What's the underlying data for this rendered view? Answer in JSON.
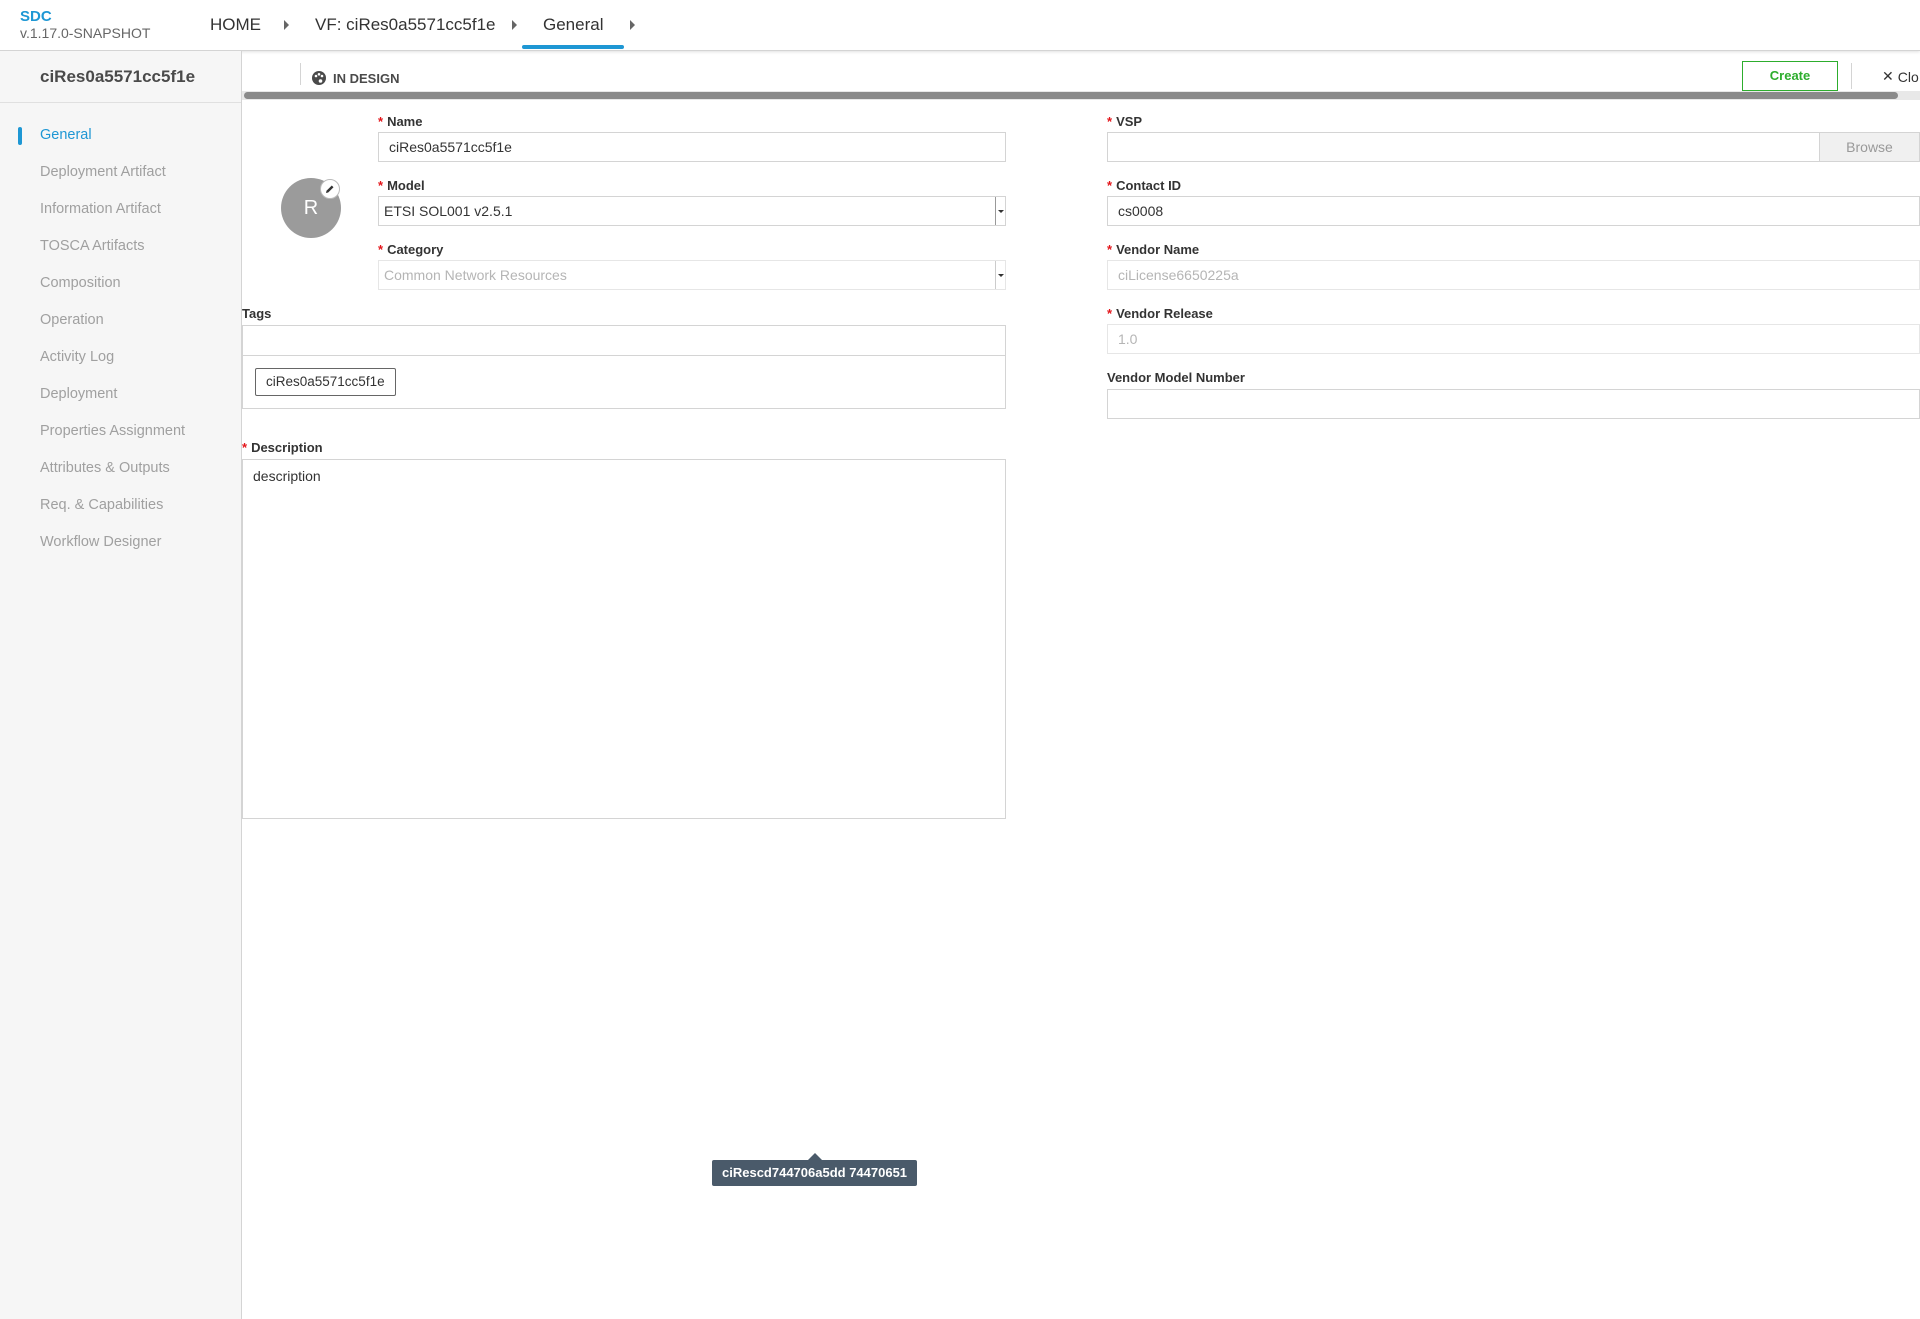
{
  "app": {
    "name": "SDC",
    "version": "v.1.17.0-SNAPSHOT"
  },
  "breadcrumb": {
    "home": "HOME",
    "vf": "VF: ciRes0a5571cc5f1e",
    "current": "General"
  },
  "sidebar": {
    "title": "ciRes0a5571cc5f1e",
    "items": [
      {
        "label": "General",
        "active": true
      },
      {
        "label": "Deployment Artifact"
      },
      {
        "label": "Information Artifact"
      },
      {
        "label": "TOSCA Artifacts"
      },
      {
        "label": "Composition"
      },
      {
        "label": "Operation"
      },
      {
        "label": "Activity Log"
      },
      {
        "label": "Deployment"
      },
      {
        "label": "Properties Assignment"
      },
      {
        "label": "Attributes & Outputs"
      },
      {
        "label": "Req. & Capabilities"
      },
      {
        "label": "Workflow Designer"
      }
    ]
  },
  "status": {
    "label": "IN DESIGN"
  },
  "actions": {
    "create": "Create",
    "close": "Clo"
  },
  "avatar": {
    "letter": "R"
  },
  "form": {
    "name": {
      "label": "Name",
      "value": "ciRes0a5571cc5f1e"
    },
    "model": {
      "label": "Model",
      "value": "ETSI SOL001 v2.5.1"
    },
    "category": {
      "label": "Category",
      "value": "Common Network Resources"
    },
    "tags": {
      "label": "Tags",
      "chips": [
        "ciRes0a5571cc5f1e"
      ]
    },
    "description": {
      "label": "Description",
      "value": "description"
    },
    "vsp": {
      "label": "VSP",
      "value": "",
      "browse": "Browse"
    },
    "contact_id": {
      "label": "Contact ID",
      "value": "cs0008"
    },
    "vendor_name": {
      "label": "Vendor Name",
      "value": "ciLicense6650225a"
    },
    "vendor_release": {
      "label": "Vendor Release",
      "value": "1.0"
    },
    "vendor_model_number": {
      "label": "Vendor Model Number",
      "value": ""
    }
  },
  "tooltip": {
    "text": "ciRescd744706a5dd 74470651"
  },
  "colors": {
    "accent": "#1e97d4",
    "create": "#2dad2d",
    "required": "#e3151a"
  }
}
